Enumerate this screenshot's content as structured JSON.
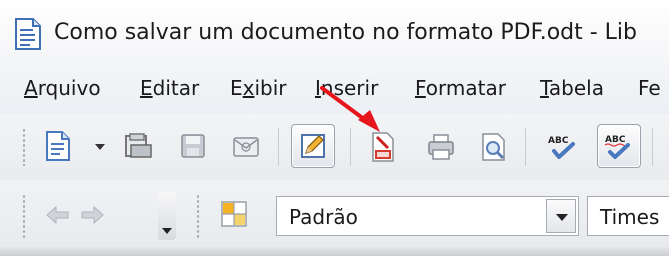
{
  "window": {
    "title": "Como salvar um documento no formato PDF.odt - Lib"
  },
  "menu": {
    "items": [
      {
        "pre": "",
        "u": "A",
        "post": "rquivo"
      },
      {
        "pre": "",
        "u": "E",
        "post": "ditar"
      },
      {
        "pre": "E",
        "u": "x",
        "post": "ibir"
      },
      {
        "pre": "",
        "u": "I",
        "post": "nserir"
      },
      {
        "pre": "",
        "u": "F",
        "post": "ormatar"
      },
      {
        "pre": "",
        "u": "T",
        "post": "abela"
      },
      {
        "pre": "",
        "u": "",
        "post": "Fe"
      }
    ]
  },
  "formatting": {
    "paragraph_style": "Padrão",
    "font_name": "Times"
  },
  "colors": {
    "annotation_arrow": "#e8141c",
    "accent_blue": "#2b62b8"
  }
}
